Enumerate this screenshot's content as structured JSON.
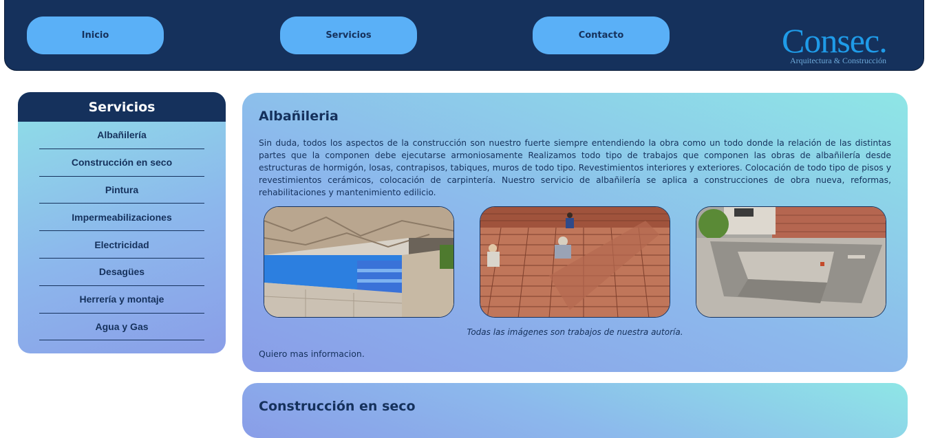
{
  "nav": {
    "items": [
      {
        "label": "Inicio"
      },
      {
        "label": "Servicios"
      },
      {
        "label": "Contacto"
      }
    ]
  },
  "logo": {
    "main": "Consec.",
    "sub": "Arquitectura & Construcción"
  },
  "sidebar": {
    "title": "Servicios",
    "items": [
      {
        "label": "Albañilería"
      },
      {
        "label": "Construcción en seco"
      },
      {
        "label": "Pintura"
      },
      {
        "label": "Impermeabilizaciones"
      },
      {
        "label": "Electricidad"
      },
      {
        "label": "Desagües"
      },
      {
        "label": "Herrería y montaje"
      },
      {
        "label": "Agua y Gas"
      }
    ]
  },
  "sections": [
    {
      "title": "Albañileria",
      "text": "Sin duda, todos los aspectos de la construcción son nuestro fuerte siempre entendiendo la obra como un todo donde la relación de las distintas partes que la componen debe ejecutarse armoniosamente Realizamos todo tipo de trabajos que componen las obras de albañilería desde estructuras de hormigón, losas, contrapisos, tabiques, muros de todo tipo. Revestimientos interiores y exteriores. Colocación de todo tipo de pisos y revestimientos cerámicos, colocación de carpintería. Nuestro servicio de albañilería se aplica a construcciones de obra nueva, reformas, rehabilitaciones y mantenimiento edilicio.",
      "caption": "Todas las imágenes son trabajos de nuestra autoría.",
      "more": "Quiero mas informacion."
    },
    {
      "title": "Construcción en seco"
    }
  ],
  "colors": {
    "navy": "#15315c",
    "button": "#5ab0f7",
    "logo": "#1f9be8"
  }
}
